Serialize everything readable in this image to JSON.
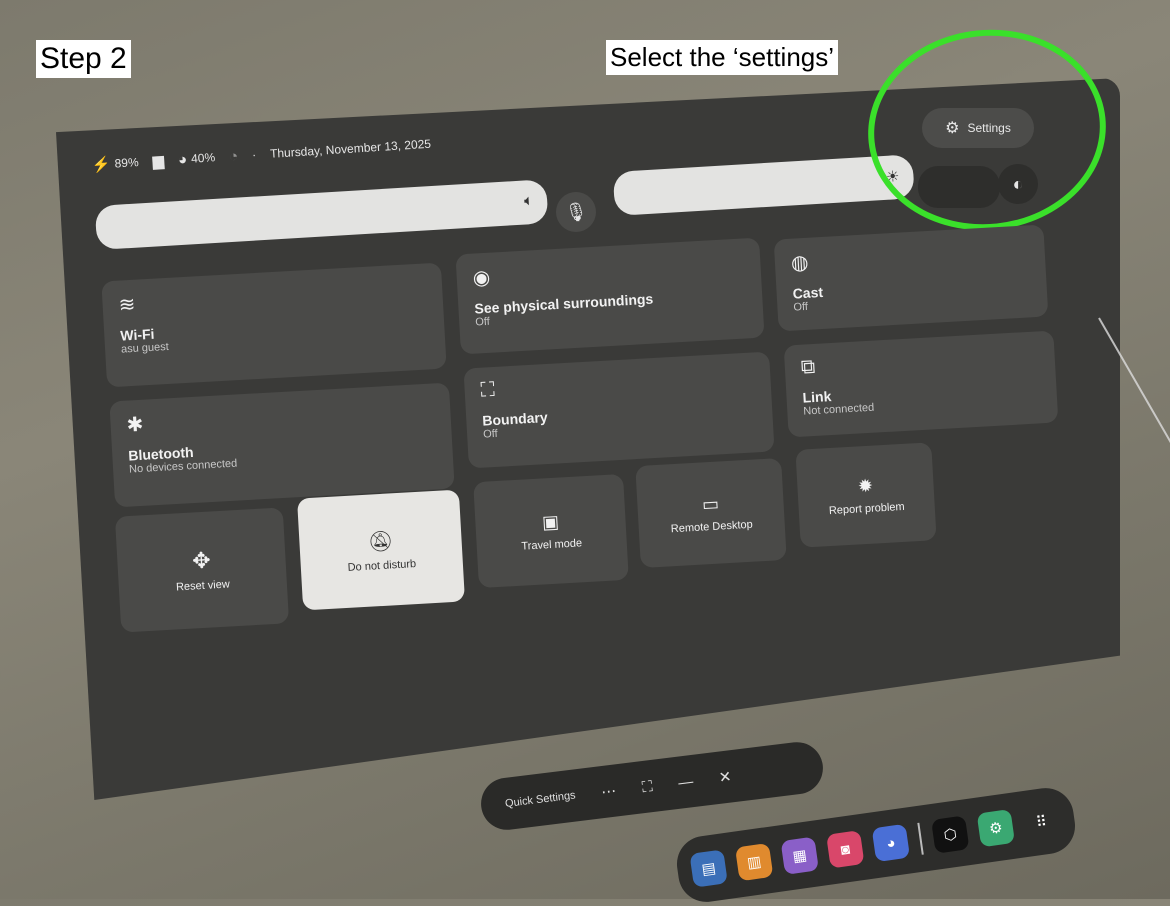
{
  "caption": {
    "step": "Step 2",
    "instruction": "Select the ‘settings’"
  },
  "status": {
    "battery": "89%",
    "controller_battery": "40%",
    "date": "Thursday, November 13, 2025"
  },
  "settings_button": {
    "label": "Settings"
  },
  "tiles": {
    "wifi": {
      "title": "Wi-Fi",
      "subtitle": "asu guest"
    },
    "bluetooth": {
      "title": "Bluetooth",
      "subtitle": "No devices connected"
    },
    "passthrough": {
      "title": "See physical surroundings",
      "subtitle": "Off"
    },
    "boundary": {
      "title": "Boundary",
      "subtitle": "Off"
    },
    "cast": {
      "title": "Cast",
      "subtitle": "Off"
    },
    "link": {
      "title": "Link",
      "subtitle": "Not connected"
    }
  },
  "small_tiles": {
    "reset_view": "Reset view",
    "do_not_disturb": "Do not disturb",
    "travel_mode": "Travel mode",
    "remote_desktop": "Remote Desktop",
    "report_problem": "Report problem"
  },
  "window_bar": {
    "title": "Quick Settings"
  },
  "colors": {
    "highlight_ring": "#3ae02a",
    "panel": "#3a3a38",
    "tile": "#4a4a48"
  },
  "dock_apps": [
    "browser",
    "store",
    "chat",
    "camera",
    "explore",
    "meta",
    "settings",
    "app-grid"
  ]
}
